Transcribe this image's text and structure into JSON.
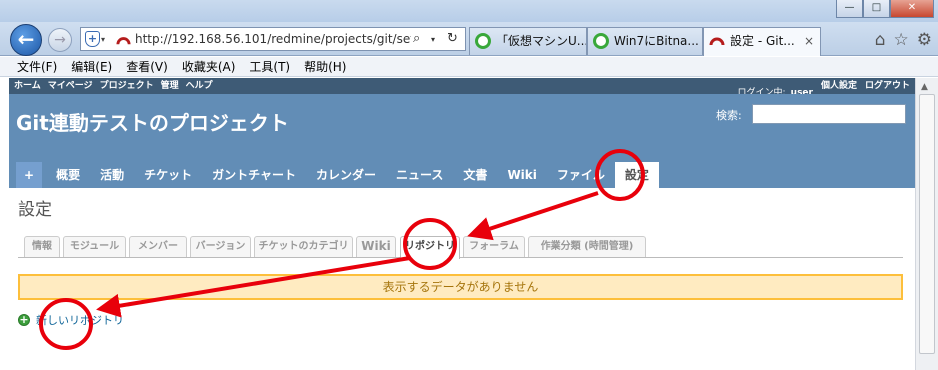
{
  "window": {
    "minimize": "—",
    "maximize": "□",
    "close": "✕"
  },
  "browser": {
    "address": "http://192.168.56.101/redmine/projects/git/set",
    "tabs": [
      {
        "label": "「仮想マシンU..."
      },
      {
        "label": "Win7にBitna..."
      },
      {
        "label": "設定 - Git..."
      }
    ],
    "tab_close": "×",
    "icons": [
      "home-icon",
      "star-icon",
      "gear-icon"
    ],
    "home": "⌂",
    "favorites": "☆",
    "tools": "⚙"
  },
  "menubar": [
    "文件(F)",
    "编辑(E)",
    "查看(V)",
    "收藏夹(A)",
    "工具(T)",
    "帮助(H)"
  ],
  "redmine": {
    "top_left": [
      "ホーム",
      "マイページ",
      "プロジェクト",
      "管理",
      "ヘルプ"
    ],
    "login_prefix": "ログイン中:",
    "login_user": "user",
    "my_account": "個人設定",
    "logout": "ログアウト",
    "project_title": "Git連動テストのプロジェクト",
    "search_label": "検索:",
    "main_menu": {
      "new": "+",
      "items": [
        "概要",
        "活動",
        "チケット",
        "ガントチャート",
        "カレンダー",
        "ニュース",
        "文書",
        "Wiki",
        "ファイル",
        "設定"
      ]
    },
    "page_heading": "設定",
    "settings_tabs": [
      "情報",
      "モジュール",
      "メンバー",
      "バージョン",
      "チケットのカテゴリ",
      "Wiki",
      "リポジトリ",
      "フォーラム",
      "作業分類 (時間管理)"
    ],
    "flash": "表示するデータがありません",
    "new_repo": "新しいリポジトリ"
  },
  "colors": {
    "header": "#628db6",
    "top_menu": "#3e5b76",
    "annotation": "#e8000b"
  }
}
